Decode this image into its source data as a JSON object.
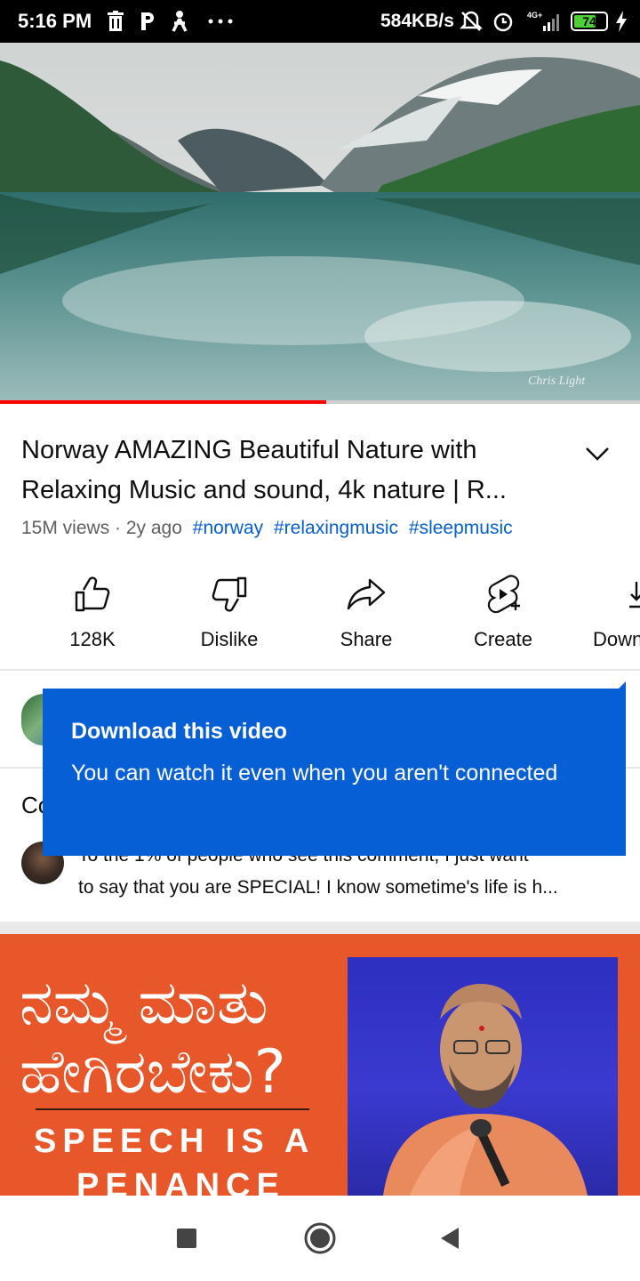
{
  "status_bar": {
    "time": "5:16 PM",
    "network_speed": "584KB/s",
    "battery_level": "74",
    "battery_fraction": 0.74,
    "icons": [
      "trash-icon",
      "parking-icon",
      "person-icon",
      "more-dots-icon",
      "mute-icon",
      "alarm-icon",
      "signal-icon",
      "charging-icon"
    ]
  },
  "player": {
    "watermark": "Chris Light",
    "progress_fraction": 0.51,
    "progress_color": "#ff0000"
  },
  "video": {
    "title": "Norway AMAZING Beautiful Nature with Relaxing Music and sound, 4k nature | R...",
    "views": "15M views · 2y ago",
    "hashtags": [
      "#norway",
      "#relaxingmusic",
      "#sleepmusic"
    ]
  },
  "actions": {
    "like": "128K",
    "dislike": "Dislike",
    "share": "Share",
    "create": "Create",
    "download": "Down"
  },
  "comments": {
    "header_partial": "Co",
    "top_comment_line1": "To the 1% of people who see this comment, I just want",
    "top_comment_line2": "to say that you are SPECIAL! I know sometime's life is h..."
  },
  "tooltip": {
    "title": "Download this video",
    "body": "You can watch it even when you aren't connected",
    "background": "#065fd4"
  },
  "promo": {
    "kannada_line1": "ನಮ್ಮ ಮಾತು",
    "kannada_line2": "ಹೇಗಿರಬೇಕು?",
    "english_line1": "SPEECH IS A",
    "english_line2": "PENANCE",
    "background": "#e8572a"
  },
  "nav": {
    "buttons": [
      "recents-square-icon",
      "home-circle-icon",
      "back-triangle-icon"
    ]
  }
}
